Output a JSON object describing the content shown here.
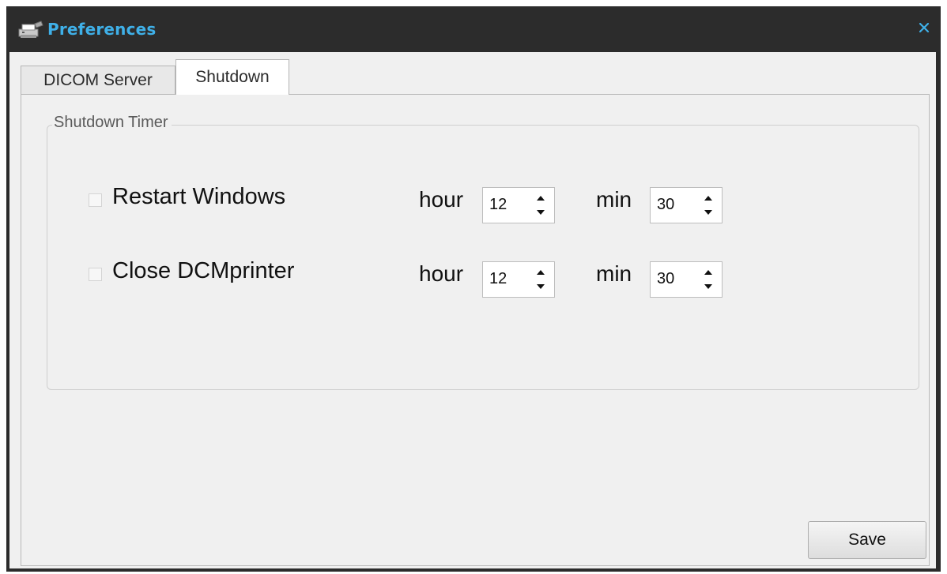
{
  "window": {
    "title": "Preferences",
    "icon": "printer-icon",
    "title_color": "#3fb0e8"
  },
  "tabs": [
    {
      "label": "DICOM Server",
      "selected": false
    },
    {
      "label": "Shutdown",
      "selected": true
    }
  ],
  "shutdown": {
    "group_title": "Shutdown Timer",
    "rows": [
      {
        "label": "Restart Windows",
        "checked": false,
        "hour_label": "hour",
        "hour": "12",
        "min_label": "min",
        "min": "30"
      },
      {
        "label": "Close DCMprinter",
        "checked": false,
        "hour_label": "hour",
        "hour": "12",
        "min_label": "min",
        "min": "30"
      }
    ]
  },
  "buttons": {
    "save": "Save"
  }
}
